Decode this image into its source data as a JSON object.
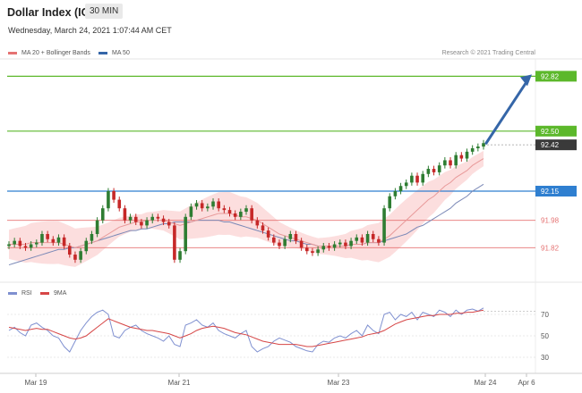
{
  "header": {
    "title": "Dollar Index (ICE)",
    "timeframe": "30 MIN"
  },
  "timestamp": "Wednesday, March 24, 2021 1:07:44 AM CET",
  "legend": {
    "bb": "MA 20 + Bollinger Bands",
    "ma50": "MA 50"
  },
  "research": "Research © 2021 Trading Central",
  "rsi_legend": {
    "rsi": "RSI",
    "ma": "9MA"
  },
  "colors": {
    "up": "#2e7d32",
    "down": "#c62828",
    "green_line": "#5cb82b",
    "blue_line": "#2f7fd0",
    "red_line": "#e57373",
    "band": "#fbd3d3",
    "ma20": "#e89a9a",
    "ma50": "#7b89b7",
    "arrow": "#3566a8",
    "rsi": "#7f90d0",
    "rsi_ma": "#d64646"
  },
  "chart_data": [
    {
      "type": "candlestick",
      "x_ticks": [
        "Mar 19",
        "Mar 21",
        "Mar 23",
        "Mar 24",
        "Apr 6"
      ],
      "ylim": [
        91.65,
        92.9
      ],
      "levels": [
        {
          "value": 92.82,
          "label": "92.82",
          "style": "green"
        },
        {
          "value": 92.5,
          "label": "92.50",
          "style": "green"
        },
        {
          "value": 92.42,
          "label": "92.42",
          "style": "current"
        },
        {
          "value": 92.15,
          "label": "92.15",
          "style": "blue"
        },
        {
          "value": 91.98,
          "label": "91.98",
          "style": "red"
        },
        {
          "value": 91.82,
          "label": "91.82",
          "style": "red"
        }
      ],
      "forecast_arrow": {
        "from": 92.43,
        "to": 92.82
      },
      "closes": [
        91.84,
        91.86,
        91.83,
        91.82,
        91.84,
        91.85,
        91.9,
        91.87,
        91.85,
        91.88,
        91.83,
        91.78,
        91.75,
        91.8,
        91.86,
        91.9,
        91.98,
        92.05,
        92.15,
        92.1,
        92.05,
        91.98,
        92.0,
        91.97,
        91.95,
        91.98,
        92.0,
        91.99,
        91.97,
        91.95,
        91.75,
        91.8,
        92.0,
        92.06,
        92.08,
        92.05,
        92.06,
        92.09,
        92.05,
        92.04,
        92.02,
        92.0,
        92.03,
        92.05,
        91.98,
        91.95,
        91.92,
        91.88,
        91.85,
        91.83,
        91.87,
        91.9,
        91.86,
        91.82,
        91.8,
        91.79,
        91.81,
        91.83,
        91.82,
        91.84,
        91.85,
        91.83,
        91.86,
        91.88,
        91.85,
        91.9,
        91.87,
        91.85,
        92.05,
        92.12,
        92.15,
        92.18,
        92.2,
        92.24,
        92.2,
        92.25,
        92.28,
        92.26,
        92.3,
        92.33,
        92.3,
        92.36,
        92.34,
        92.38,
        92.4,
        92.41,
        92.43
      ],
      "series": [
        {
          "name": "MA 20",
          "values": [
            91.84,
            91.84,
            91.84,
            91.84,
            91.85,
            91.85,
            91.85,
            91.85,
            91.85,
            91.85,
            91.84,
            91.83,
            91.82,
            91.83,
            91.84,
            91.85,
            91.86,
            91.88,
            91.9,
            91.92,
            91.94,
            91.95,
            91.96,
            91.97,
            91.97,
            91.98,
            91.98,
            91.98,
            91.98,
            91.97,
            91.96,
            91.95,
            91.96,
            91.97,
            91.98,
            91.99,
            92.0,
            92.01,
            92.02,
            92.02,
            92.02,
            92.01,
            92.0,
            92.0,
            91.99,
            91.98,
            91.96,
            91.94,
            91.92,
            91.9,
            91.89,
            91.88,
            91.87,
            91.86,
            91.85,
            91.84,
            91.83,
            91.83,
            91.83,
            91.83,
            91.83,
            91.83,
            91.84,
            91.84,
            91.84,
            91.85,
            91.85,
            91.85,
            91.87,
            91.89,
            91.92,
            91.95,
            91.98,
            92.01,
            92.04,
            92.07,
            92.1,
            92.12,
            92.15,
            92.18,
            92.2,
            92.23,
            92.25,
            92.27,
            92.3,
            92.32,
            92.34
          ]
        },
        {
          "name": "MA 50",
          "values": [
            91.72,
            91.73,
            91.74,
            91.75,
            91.76,
            91.77,
            91.78,
            91.79,
            91.8,
            91.81,
            91.81,
            91.82,
            91.82,
            91.83,
            91.84,
            91.85,
            91.86,
            91.87,
            91.88,
            91.89,
            91.9,
            91.91,
            91.92,
            91.92,
            91.93,
            91.93,
            91.94,
            91.95,
            91.96,
            91.96,
            91.97,
            91.97,
            91.97,
            91.97,
            91.98,
            91.98,
            91.98,
            91.98,
            91.98,
            91.97,
            91.97,
            91.96,
            91.95,
            91.94,
            91.93,
            91.92,
            91.91,
            91.9,
            91.89,
            91.88,
            91.87,
            91.86,
            91.86,
            91.85,
            91.84,
            91.84,
            91.83,
            91.83,
            91.83,
            91.83,
            91.83,
            91.83,
            91.84,
            91.84,
            91.84,
            91.85,
            91.85,
            91.85,
            91.86,
            91.87,
            91.88,
            91.89,
            91.9,
            91.92,
            91.94,
            91.95,
            91.97,
            91.99,
            92.01,
            92.03,
            92.05,
            92.08,
            92.1,
            92.12,
            92.15,
            92.17,
            92.19
          ]
        }
      ]
    },
    {
      "type": "line",
      "name": "RSI",
      "ylim": [
        20,
        80
      ],
      "ticks": [
        70,
        50,
        30
      ],
      "series": [
        {
          "name": "RSI",
          "values": [
            55,
            58,
            53,
            50,
            60,
            62,
            58,
            55,
            50,
            48,
            40,
            35,
            45,
            55,
            62,
            68,
            72,
            74,
            70,
            50,
            48,
            55,
            58,
            60,
            55,
            52,
            50,
            48,
            45,
            50,
            42,
            40,
            60,
            62,
            65,
            60,
            58,
            62,
            55,
            52,
            50,
            48,
            52,
            55,
            40,
            35,
            38,
            40,
            45,
            48,
            46,
            44,
            40,
            38,
            36,
            35,
            42,
            45,
            44,
            48,
            50,
            48,
            52,
            55,
            50,
            60,
            55,
            52,
            70,
            72,
            65,
            70,
            68,
            72,
            65,
            72,
            70,
            68,
            74,
            72,
            68,
            74,
            70,
            74,
            75,
            73,
            76
          ]
        },
        {
          "name": "9MA",
          "values": [
            58,
            57,
            56,
            55,
            56,
            57,
            56,
            56,
            54,
            52,
            50,
            48,
            47,
            48,
            50,
            54,
            58,
            62,
            66,
            64,
            62,
            60,
            58,
            57,
            56,
            55,
            55,
            54,
            53,
            52,
            50,
            48,
            50,
            52,
            55,
            57,
            58,
            59,
            58,
            57,
            55,
            53,
            52,
            51,
            49,
            47,
            45,
            44,
            43,
            42,
            42,
            42,
            42,
            41,
            40,
            40,
            41,
            42,
            43,
            44,
            45,
            46,
            47,
            48,
            49,
            51,
            52,
            53,
            55,
            58,
            61,
            63,
            65,
            66,
            67,
            68,
            69,
            69,
            70,
            70,
            70,
            71,
            71,
            72,
            72,
            73,
            74
          ]
        }
      ]
    }
  ]
}
